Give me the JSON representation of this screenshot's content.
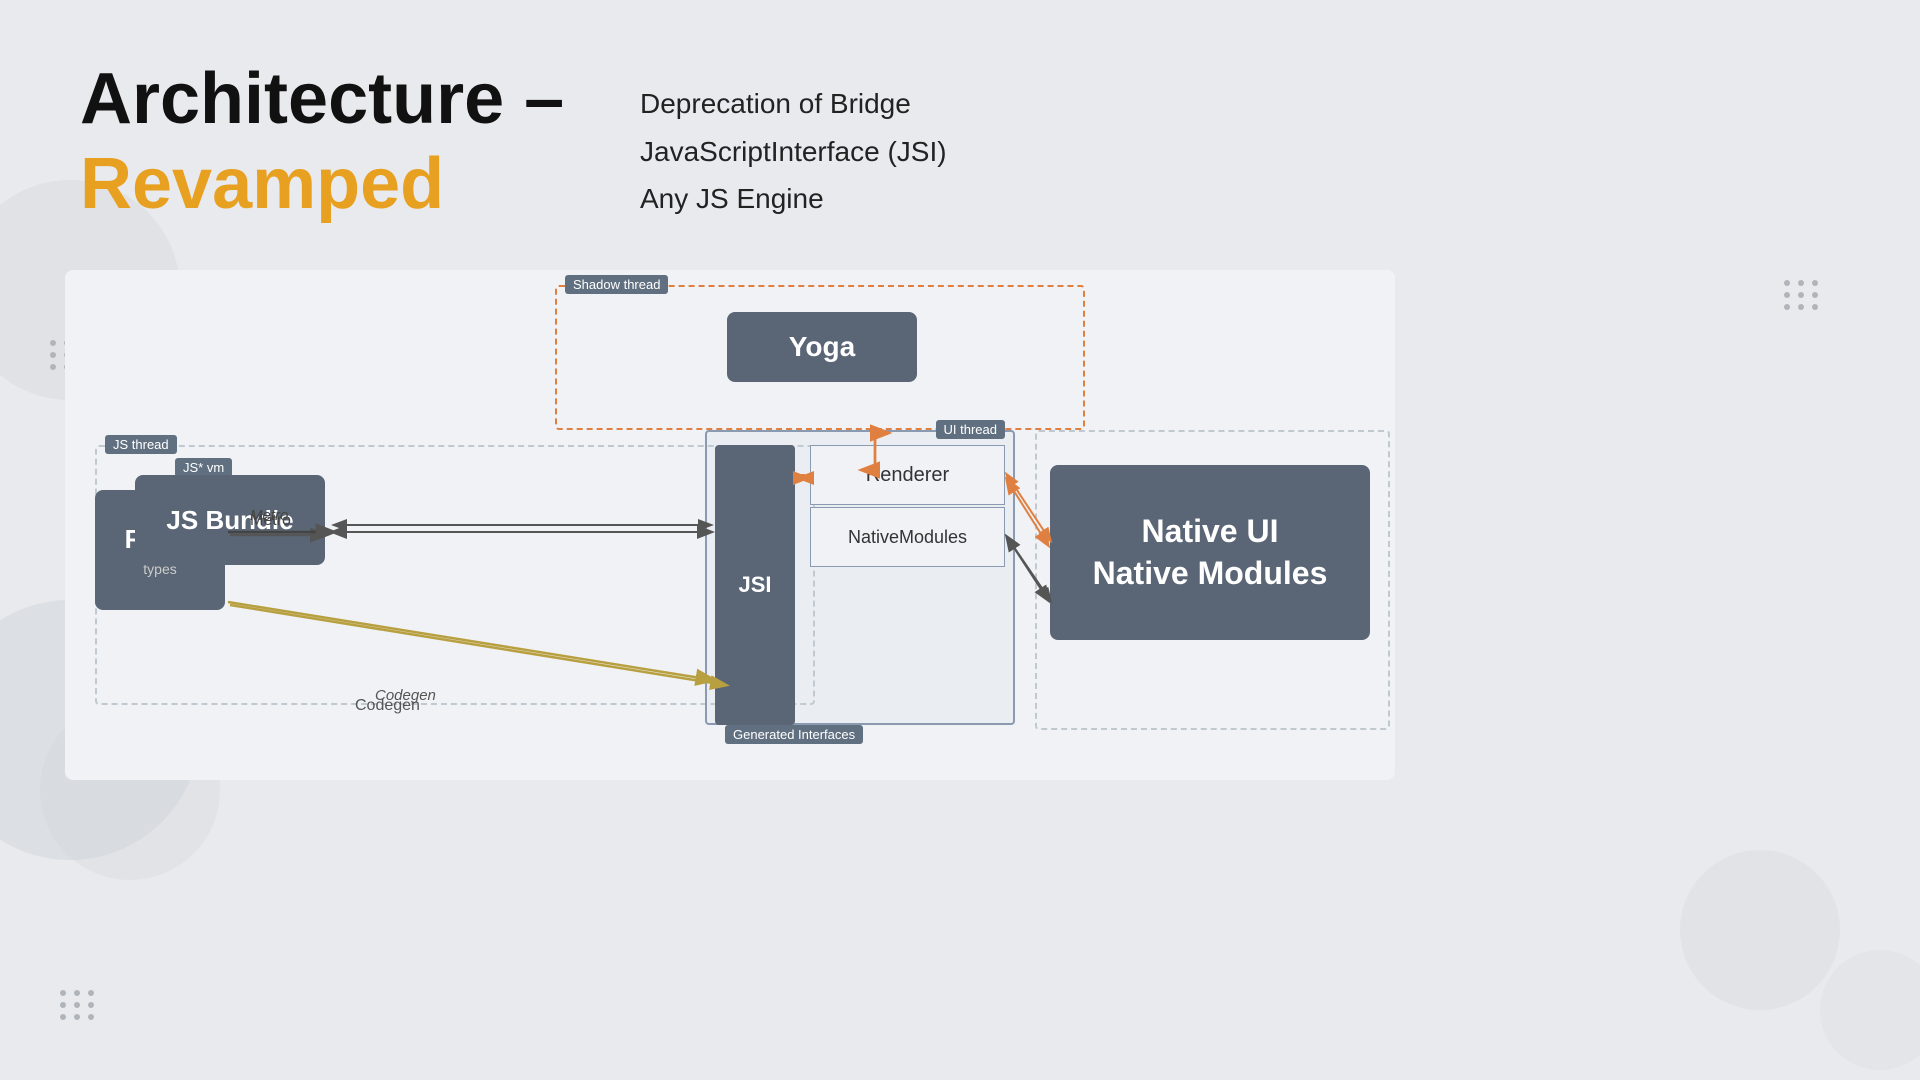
{
  "header": {
    "title_part1": "Architecture –",
    "title_part2": "Revamped",
    "features": [
      "Deprecation of Bridge",
      "JavaScriptInterface (JSI)",
      "Any JS Engine"
    ]
  },
  "diagram": {
    "shadow_thread_label": "Shadow thread",
    "yoga_label": "Yoga",
    "js_thread_label": "JS thread",
    "ui_thread_label": "UI thread",
    "jsvm_label": "JS* vm",
    "js_bundle_label": "JS Bundle",
    "jsi_label": "JSI",
    "react_label": "React",
    "react_types": "types",
    "metro_label": "Metro",
    "codegen_label": "Codegen",
    "renderer_label": "Renderer",
    "native_modules_inner_label": "NativeModules",
    "generated_interfaces_label": "Generated Interfaces",
    "native_ui_label": "Native UI\nNative Modules"
  }
}
